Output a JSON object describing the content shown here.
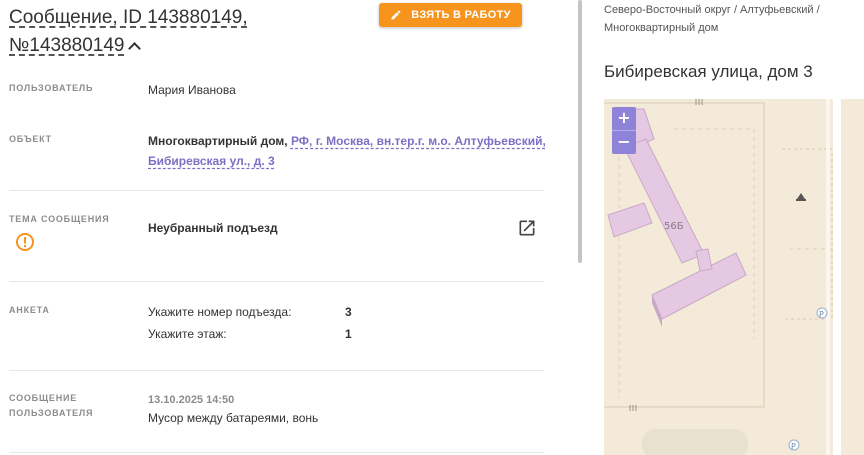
{
  "header": {
    "title_line1": "Сообщение, ID 143880149,",
    "title_line2": "№143880149",
    "take_button": "ВЗЯТЬ В РАБОТУ"
  },
  "fields": {
    "user": {
      "label": "ПОЛЬЗОВАТЕЛЬ",
      "value": "Мария Иванова"
    },
    "object": {
      "label": "ОБЪЕКТ",
      "type": "Многоквартирный дом,",
      "address_part1": "РФ, г. Москва, вн.тер.г. м.о. Алтуфьевский,",
      "address_part2": "Бибиревская ул., д. 3"
    },
    "topic": {
      "label": "ТЕМА СООБЩЕНИЯ",
      "value": "Неубранный подъезд"
    },
    "survey": {
      "label": "АНКЕТА",
      "rows": [
        {
          "question": "Укажите номер подъезда:",
          "answer": "3"
        },
        {
          "question": "Укажите этаж:",
          "answer": "1"
        }
      ]
    },
    "message": {
      "label_line1": "СООБЩЕНИЕ",
      "label_line2": "ПОЛЬЗОВАТЕЛЯ",
      "date": "13.10.2025 14:50",
      "text": "Мусор между батареями, вонь"
    }
  },
  "sidebar": {
    "breadcrumb_line1": "Северо-Восточный округ / Алтуфьевский /",
    "breadcrumb_line2": "Многоквартирный дом",
    "address_title": "Бибиревская улица, дом 3",
    "map": {
      "zoom_in": "+",
      "zoom_out": "−",
      "building_label": "56Б",
      "parking_label": "P"
    }
  },
  "colors": {
    "accent": "#f7941d",
    "link": "#7c6fc4",
    "warning": "#f7941d",
    "map_zoom": "#8e83d8"
  }
}
